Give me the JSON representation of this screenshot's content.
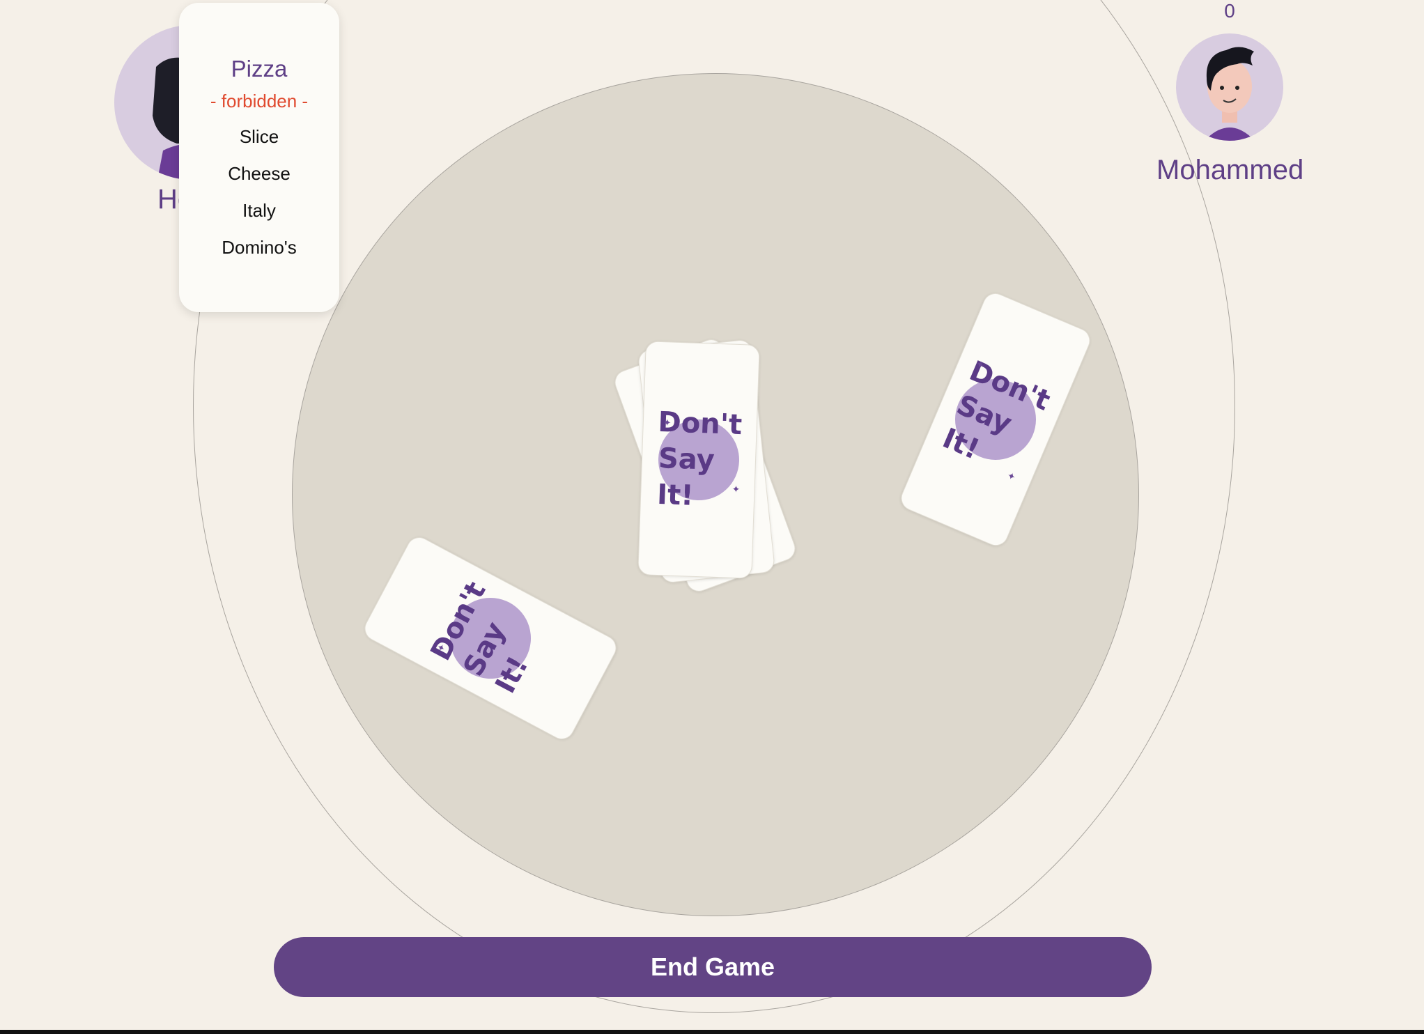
{
  "players": [
    {
      "name": "He",
      "avatar_icon": "woman-avatar-icon"
    },
    {
      "name": "Mohammed",
      "score": "0",
      "avatar_icon": "man-avatar-icon"
    }
  ],
  "word_card": {
    "target": "Pizza",
    "forbidden_label": "- forbidden -",
    "forbidden_words": [
      "Slice",
      "Cheese",
      "Italy",
      "Domino's"
    ]
  },
  "card_logo": {
    "line1": "Don't",
    "line2": "Say It!"
  },
  "end_button": "End Game",
  "colors": {
    "accent": "#624485",
    "background": "#f5f0e8",
    "table": "#ddd8cd",
    "forbidden": "#e04a2f",
    "logo_circle": "#b9a4d1"
  }
}
